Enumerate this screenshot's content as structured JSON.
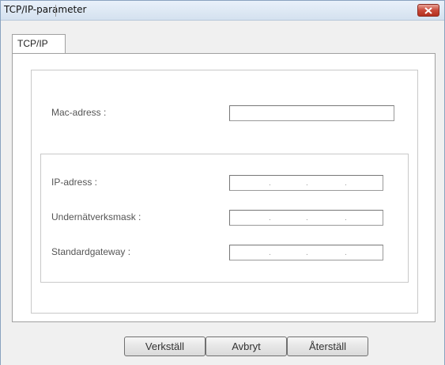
{
  "window": {
    "title": "TCP/IP-parameter"
  },
  "tabs": [
    {
      "label": "TCP/IP"
    }
  ],
  "mac": {
    "label": "Mac-adress :",
    "value": ""
  },
  "ip": {
    "label": "IP-adress :",
    "value": "",
    "dots": [
      ".",
      ".",
      "."
    ]
  },
  "subnet": {
    "label": "Undernätverksmask :",
    "value": "",
    "dots": [
      ".",
      ".",
      "."
    ]
  },
  "gateway": {
    "label": "Standardgateway :",
    "value": "",
    "dots": [
      ".",
      ".",
      "."
    ]
  },
  "buttons": {
    "apply": "Verkställ",
    "cancel": "Avbryt",
    "reset": "Återställ"
  },
  "colors": {
    "title_bg": "#d4e1ef",
    "close_button": "#c8493a",
    "window_bg": "#f0f0f0"
  }
}
